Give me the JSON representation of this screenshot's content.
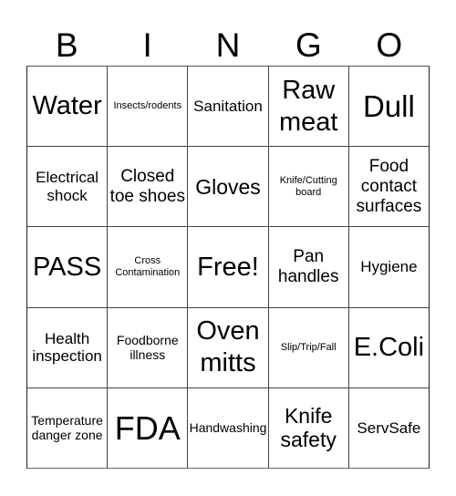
{
  "header": {
    "letters": [
      "B",
      "I",
      "N",
      "G",
      "O"
    ]
  },
  "board": {
    "rows": [
      [
        "Water",
        "Insects/rodents",
        "Sanitation",
        "Raw meat",
        "Dull"
      ],
      [
        "Electrical shock",
        "Closed toe shoes",
        "Gloves",
        "Knife/Cutting board",
        "Food contact surfaces"
      ],
      [
        "PASS",
        "Cross Contamination",
        "Free!",
        "Pan handles",
        "Hygiene"
      ],
      [
        "Health inspection",
        "Foodborne illness",
        "Oven mitts",
        "Slip/Trip/Fall",
        "E.Coli"
      ],
      [
        "Temperature danger zone",
        "FDA",
        "Handwashing",
        "Knife safety",
        "ServSafe"
      ]
    ],
    "free_space": "Free!"
  }
}
